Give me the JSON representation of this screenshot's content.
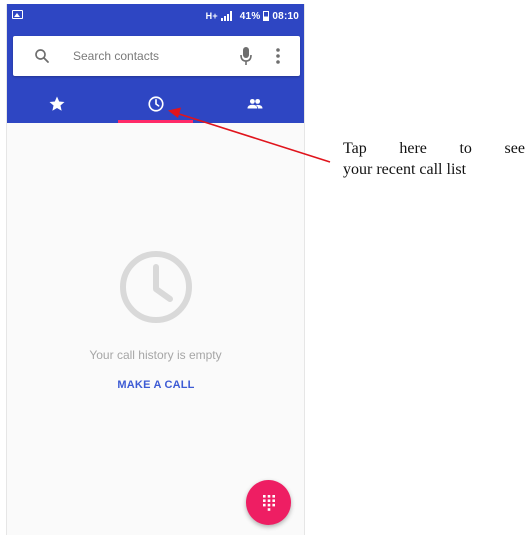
{
  "status_bar": {
    "network": "H+",
    "battery": "41%",
    "time": "08:10"
  },
  "search": {
    "placeholder": "Search contacts"
  },
  "tabs": [
    {
      "icon": "star-icon",
      "selected": false
    },
    {
      "icon": "clock-icon",
      "selected": true
    },
    {
      "icon": "people-icon",
      "selected": false
    }
  ],
  "empty_state": {
    "message": "Your call history is empty",
    "action_label": "MAKE A CALL"
  },
  "annotation": {
    "words_line1": [
      "Tap",
      "here",
      "to",
      "see"
    ],
    "line2": "your recent call list"
  },
  "colors": {
    "app_bar": "#2e46c3",
    "tab_indicator": "#ff2a68",
    "fab": "#ee1e63",
    "action_text": "#3d5bd4",
    "arrow": "#e0141c"
  }
}
